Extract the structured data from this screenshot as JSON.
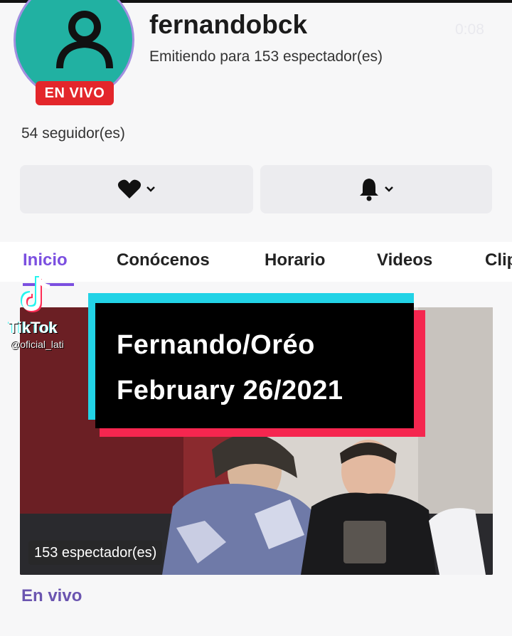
{
  "profile": {
    "username": "fernandobck",
    "streaming_text": "Emitiendo para 153 espectador(es)",
    "live_badge": "EN VIVO",
    "followers": "54 seguidor(es)",
    "avatar_color": "#21b1a2"
  },
  "timer": "0:08",
  "actions": {
    "follow_icon": "heart-icon",
    "notify_icon": "bell-icon"
  },
  "tabs": [
    {
      "label": "Inicio",
      "active": true
    },
    {
      "label": "Conócenos",
      "active": false
    },
    {
      "label": "Horario",
      "active": false
    },
    {
      "label": "Videos",
      "active": false
    },
    {
      "label": "Clip",
      "active": false
    }
  ],
  "video": {
    "viewers": "153 espectador(es)",
    "section_label": "En vivo"
  },
  "watermark": {
    "brand": "TikTok",
    "handle": "@oficial_lati"
  },
  "caption": {
    "line1": "Fernando/Oréo",
    "line2": "February 26/2021"
  },
  "colors": {
    "accent": "#7b4fe0",
    "live": "#e3262b",
    "caption_cyan": "#22d3e6",
    "caption_red": "#f5264f"
  }
}
